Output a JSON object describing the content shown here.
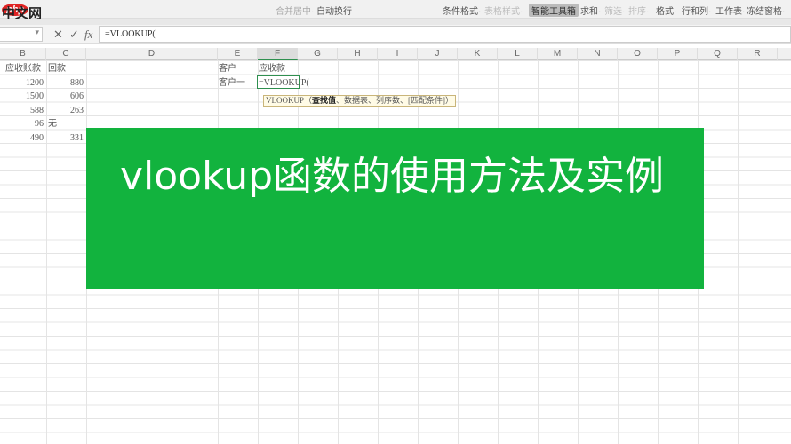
{
  "toolbar": {
    "merge": "合并居中·",
    "wrap": "自动换行",
    "cond_format": "条件格式·",
    "table_style": "表格样式·",
    "smart_tools": "智能工具箱",
    "sum": "求和·",
    "filter": "筛选·",
    "sort": "排序·",
    "format": "格式·",
    "rowcol": "行和列·",
    "sheet": "工作表·",
    "freeze": "冻结窗格·"
  },
  "logo": {
    "php": "php",
    "cn": "中文网"
  },
  "formula_bar": {
    "cancel_icon": "✕",
    "confirm_icon": "✓",
    "fx": "fx",
    "value": "=VLOOKUP("
  },
  "columns": [
    "B",
    "C",
    "D",
    "E",
    "F",
    "G",
    "H",
    "I",
    "J",
    "K",
    "L",
    "M",
    "N",
    "O",
    "P",
    "Q",
    "R"
  ],
  "cells": {
    "b1": "应收账款",
    "c1": "回款",
    "b2": "1200",
    "c2": "880",
    "b3": "1500",
    "c3": "606",
    "b4": "588",
    "c4": "263",
    "b5": "96",
    "c5": "无",
    "b6": "490",
    "c6": "331",
    "e1": "客户",
    "f1": "应收款",
    "e2": "客户一",
    "f2": "=VLOOKUP("
  },
  "tooltip": {
    "fn": "VLOOKUP",
    "open": "（",
    "arg1": "查找值",
    "rest": "、数据表、列序数、[匹配条件]）"
  },
  "banner": {
    "title": "vlookup函数的使用方法及实例",
    "color": "#12b33e"
  }
}
